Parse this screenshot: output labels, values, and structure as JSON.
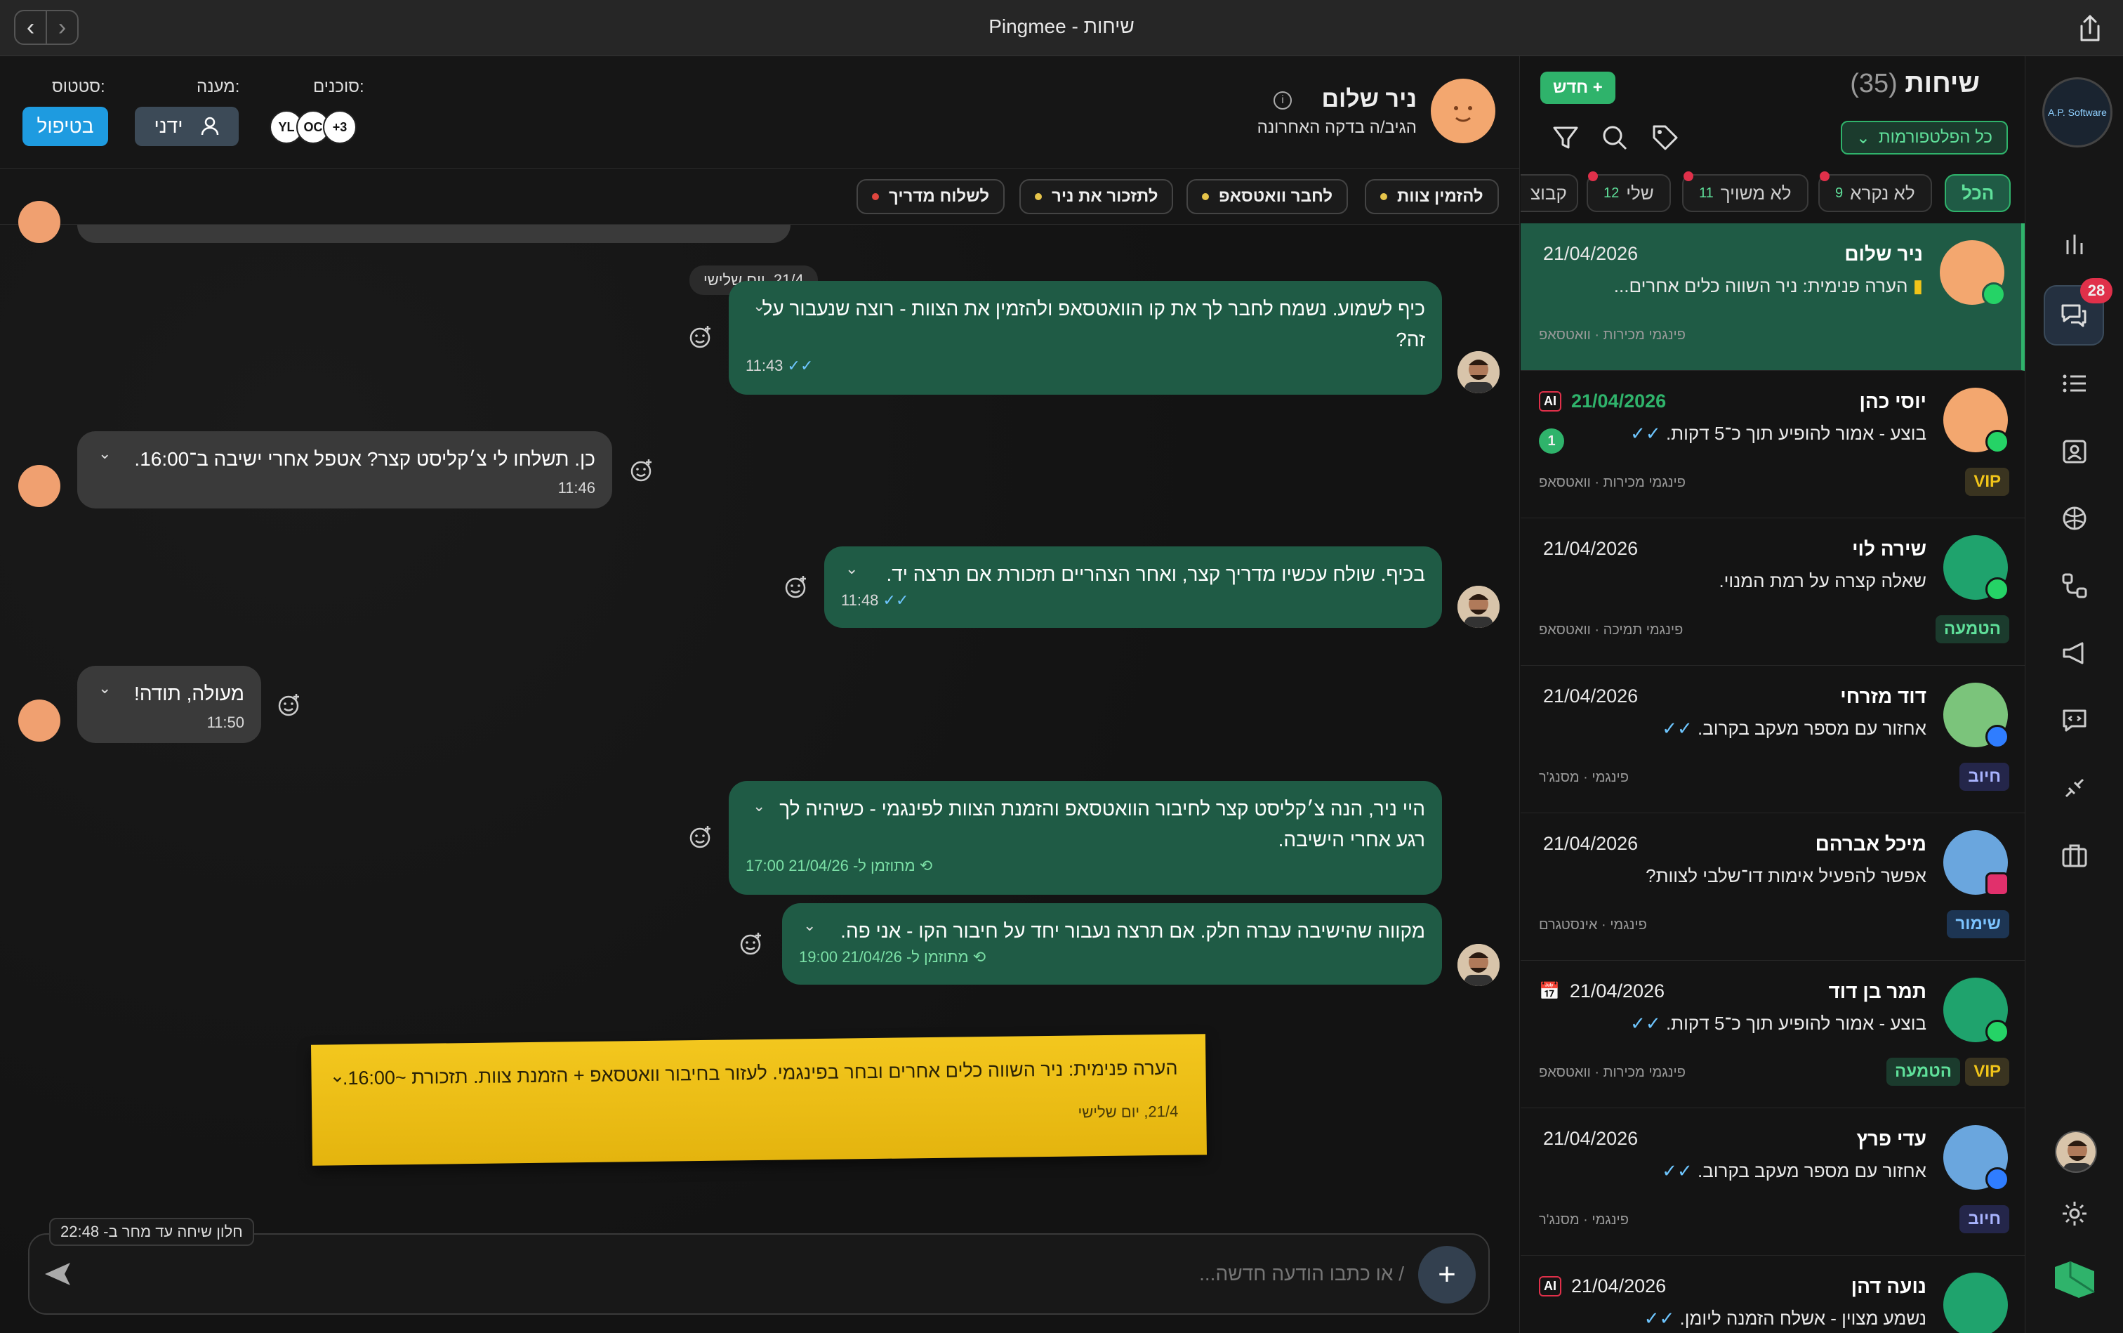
{
  "window": {
    "title": "Pingmee - שיחות"
  },
  "chat_header": {
    "name": "ניר שלום",
    "subtitle": "הגיב/ה בדקה האחרונה",
    "agents_label": "סוכנים:",
    "agents": [
      "YL",
      "OC",
      "+3"
    ],
    "responder_label": "מענה:",
    "responder": "ידני",
    "status_label": "סטטוס:",
    "status": "בטיפול"
  },
  "tags": [
    {
      "label": "להזמין צוות",
      "color": "#e6c44a"
    },
    {
      "label": "לחבר וואטסאפ",
      "color": "#e6c44a"
    },
    {
      "label": "לתזכור את ניר",
      "color": "#e6c44a"
    },
    {
      "label": "לשלוח מדריך",
      "color": "#e0463f"
    }
  ],
  "messages": [
    {
      "date_chip": "21/4, יום שלישי",
      "text": "כיף לשמוע. נשמח לחבר לך את קו הוואטסאפ ולהזמין את הצוות - רוצה שנעבור על זה?",
      "time": "11:43"
    },
    {
      "text": "כן. תשלחו לי צ׳קליסט קצר? אטפל אחרי ישיבה ב־16:00.",
      "time": "11:46"
    },
    {
      "text": "בכיף. שולח עכשיו מדריך קצר, ואחר הצהריים תזכורת אם תרצה יד.",
      "time": "11:48"
    },
    {
      "text": "מעולה, תודה!",
      "time": "11:50"
    },
    {
      "text": "היי ניר, הנה צ׳קליסט קצר לחיבור הוואטסאפ והזמנת הצוות לפינגמי - כשיהיה לך רגע אחרי הישיבה.",
      "time": "מתוזמן ל- 21/04/26 17:00"
    },
    {
      "text": "מקווה שהישיבה עברה חלק. אם תרצה נעבור יחד על חיבור הקו - אני פה.",
      "time": "מתוזמן ל- 21/04/26 19:00"
    }
  ],
  "internal_note": {
    "text": "הערה פנימית: ניר השווה כלים אחרים ובחר בפינגמי. לעזור בחיבור וואטסאפ + הזמנת צוות. תזכורת ~16:00.",
    "date": "21/4, יום שלישי"
  },
  "composer": {
    "window_note": "חלון שיחה עד מחר ב- 22:48",
    "placeholder": "/ או כתבו הודעה חדשה..."
  },
  "sidebar": {
    "title": "שיחות",
    "count": "(35)",
    "new_button": "+ חדש",
    "platform_filter": "כל הפלטפורמות",
    "filters": [
      {
        "label": "הכל"
      },
      {
        "label": "לא נקרא",
        "count": "9"
      },
      {
        "label": "לא משויך",
        "count": "11"
      },
      {
        "label": "שלי",
        "count": "12"
      },
      {
        "label": "קבוצ"
      }
    ],
    "conversations": [
      {
        "name": "ניר שלום",
        "date": "21/04/2026",
        "preview": "הערה פנימית: ניר השווה כלים אחרים...",
        "meta": "פינגמי מכירות · וואטסאפ",
        "badges": []
      },
      {
        "name": "יוסי כהן",
        "date": "21/04/2026",
        "preview": "בוצע - אמור להופיע תוך כ־5 דקות.",
        "meta": "פינגמי מכירות · וואטסאפ",
        "badges": [
          "VIP"
        ],
        "unread": "1",
        "ai": "AI"
      },
      {
        "name": "שירה לוי",
        "date": "21/04/2026",
        "preview": "שאלה קצרה על רמת המנוי.",
        "meta": "פינגמי תמיכה · וואטסאפ",
        "badges": [
          "הטמעה"
        ]
      },
      {
        "name": "דוד מזרחי",
        "date": "21/04/2026",
        "preview": "אחזור עם מספר מעקב בקרוב.",
        "meta": "פינגמי · מסנג'ר",
        "badges": [
          "חיוב"
        ]
      },
      {
        "name": "מיכל אברהם",
        "date": "21/04/2026",
        "preview": "אפשר להפעיל אימות דו־שלבי לצוות?",
        "meta": "פינגמי · אינסטגרם",
        "badges": [
          "שימור"
        ]
      },
      {
        "name": "תמר בן דוד",
        "date": "21/04/2026",
        "preview": "בוצע - אמור להופיע תוך כ־5 דקות.",
        "meta": "פינגמי מכירות · וואטסאפ",
        "badges": [
          "VIP",
          "הטמעה"
        ]
      },
      {
        "name": "עדי פרץ",
        "date": "21/04/2026",
        "preview": "אחזור עם מספר מעקב בקרוב.",
        "meta": "פינגמי · מסנג'ר",
        "badges": [
          "חיוב"
        ]
      },
      {
        "name": "נועה דהן",
        "date": "21/04/2026",
        "preview": "נשמע מצוין - אשלח הזמנה ליומן.",
        "meta": "",
        "badges": [],
        "ai": "AI"
      }
    ]
  },
  "rail": {
    "logo": "A.P. Software",
    "notifications": "28"
  },
  "colors": {
    "accent_green": "#1f5b45",
    "bright_green": "#2fb36b",
    "note_yellow": "#f0c419",
    "status_blue": "#1e9be0"
  }
}
